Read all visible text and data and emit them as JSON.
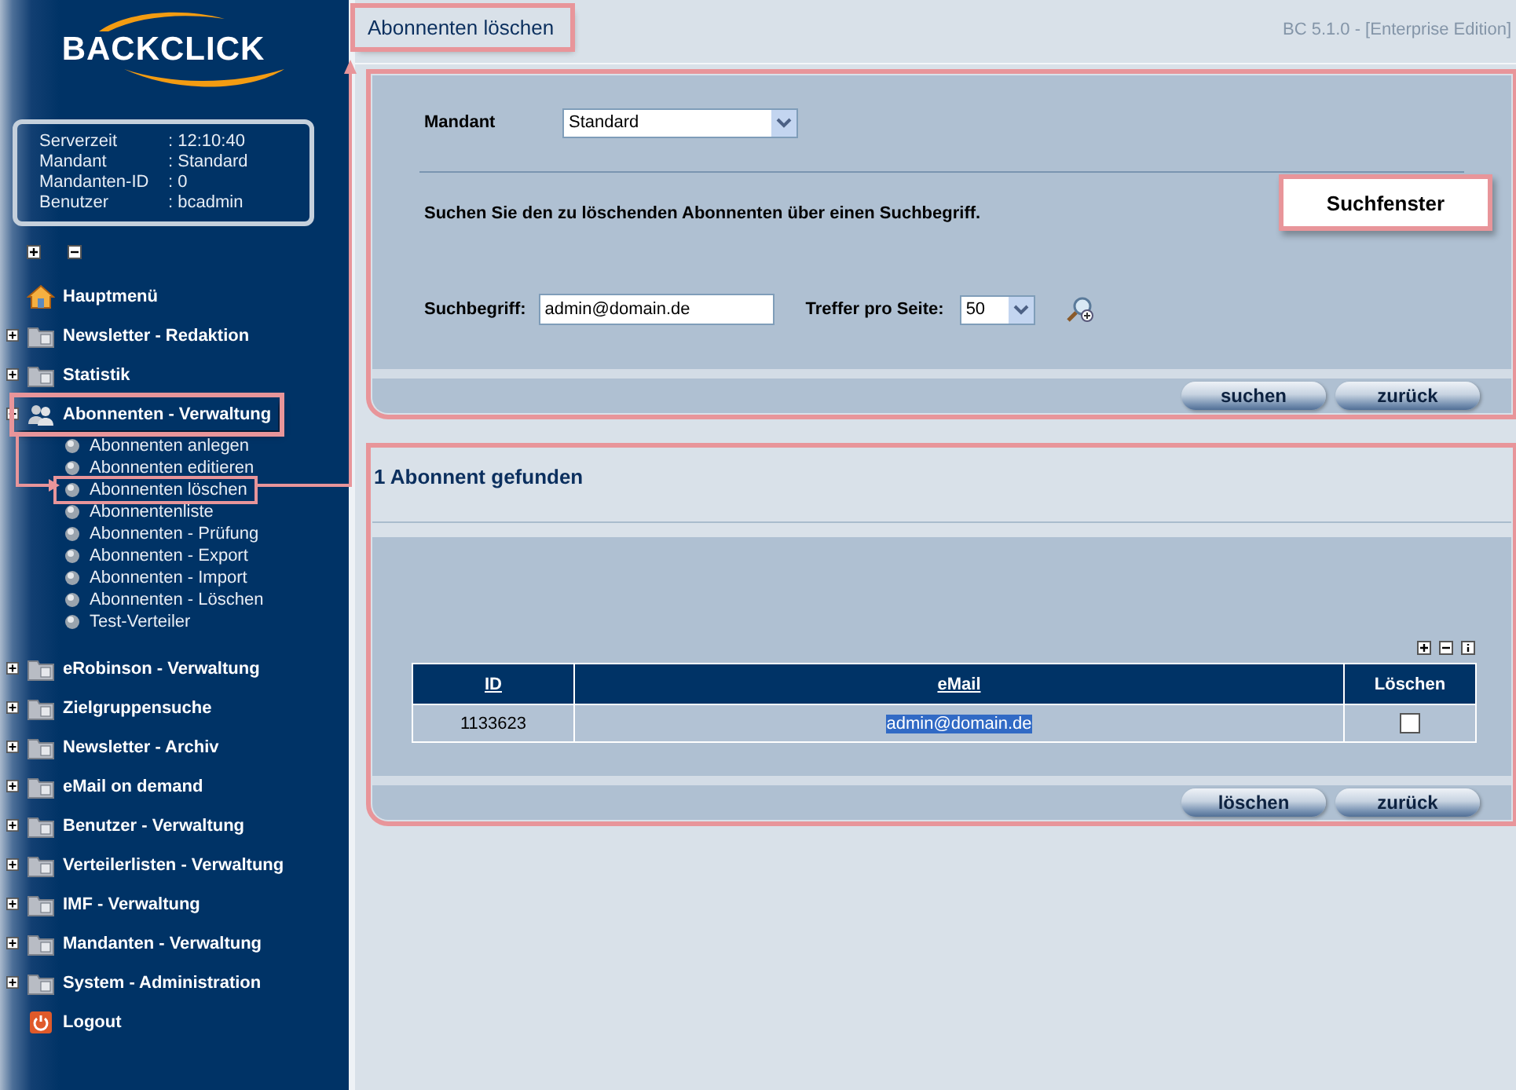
{
  "sidebar": {
    "logo": "BACKCLICK",
    "info": [
      {
        "label": "Serverzeit",
        "value": ": 12:10:40"
      },
      {
        "label": "Mandant",
        "value": ": Standard"
      },
      {
        "label": "Mandanten-ID",
        "value": ": 0"
      },
      {
        "label": "Benutzer",
        "value": ": bcadmin"
      }
    ],
    "menu": [
      {
        "kind": "home",
        "label": "Hauptmenü",
        "annotated": false
      },
      {
        "kind": "folder",
        "label": "Newsletter - Redaktion",
        "expanded": false,
        "annotated": false
      },
      {
        "kind": "folder",
        "label": "Statistik",
        "expanded": false,
        "annotated": false
      },
      {
        "kind": "users",
        "label": "Abonnenten - Verwaltung",
        "expanded": true,
        "annotated": true,
        "children": [
          {
            "label": "Abonnenten anlegen",
            "annotated": false
          },
          {
            "label": "Abonnenten editieren",
            "annotated": false
          },
          {
            "label": "Abonnenten löschen",
            "annotated": true
          },
          {
            "label": "Abonnentenliste",
            "annotated": false
          },
          {
            "label": "Abonnenten - Prüfung",
            "annotated": false
          },
          {
            "label": "Abonnenten - Export",
            "annotated": false
          },
          {
            "label": "Abonnenten - Import",
            "annotated": false
          },
          {
            "label": "Abonnenten - Löschen",
            "annotated": false
          },
          {
            "label": "Test-Verteiler",
            "annotated": false
          }
        ]
      },
      {
        "kind": "folder",
        "label": "eRobinson - Verwaltung",
        "expanded": false,
        "annotated": false
      },
      {
        "kind": "folder",
        "label": "Zielgruppensuche",
        "expanded": false,
        "annotated": false
      },
      {
        "kind": "folder",
        "label": "Newsletter - Archiv",
        "expanded": false,
        "annotated": false
      },
      {
        "kind": "folder",
        "label": "eMail on demand",
        "expanded": false,
        "annotated": false
      },
      {
        "kind": "folder",
        "label": "Benutzer - Verwaltung",
        "expanded": false,
        "annotated": false
      },
      {
        "kind": "folder",
        "label": "Verteilerlisten - Verwaltung",
        "expanded": false,
        "annotated": false
      },
      {
        "kind": "folder",
        "label": "IMF - Verwaltung",
        "expanded": false,
        "annotated": false
      },
      {
        "kind": "folder",
        "label": "Mandanten - Verwaltung",
        "expanded": false,
        "annotated": false
      },
      {
        "kind": "folder",
        "label": "System - Administration",
        "expanded": false,
        "annotated": false
      },
      {
        "kind": "logout",
        "label": "Logout",
        "annotated": false
      }
    ]
  },
  "page_title": {
    "text": "Abonnenten löschen",
    "annotated": true
  },
  "version": "BC 5.1.0 - [Enterprise Edition]",
  "search_panel": {
    "annotated": true,
    "callout": "Suchfenster",
    "mandant": {
      "label": "Mandant",
      "value": "Standard"
    },
    "description": "Suchen Sie den zu löschenden Abonnenten über einen Suchbegriff.",
    "search_term": {
      "label": "Suchbegriff:",
      "value": "admin@domain.de"
    },
    "hits_per_page": {
      "label": "Treffer pro Seite:",
      "value": "50"
    },
    "buttons": [
      "suchen",
      "zurück"
    ]
  },
  "results_panel": {
    "annotated": true,
    "heading": "1 Abonnent gefunden",
    "table": {
      "columns": [
        {
          "label": "ID",
          "sortable": true
        },
        {
          "label": "eMail",
          "sortable": true
        },
        {
          "label": "Löschen",
          "sortable": false
        }
      ],
      "rows": [
        {
          "id": "1133623",
          "email": "admin@domain.de",
          "email_highlighted": true,
          "checked": false
        }
      ]
    },
    "buttons": [
      "löschen",
      "zurück"
    ]
  }
}
